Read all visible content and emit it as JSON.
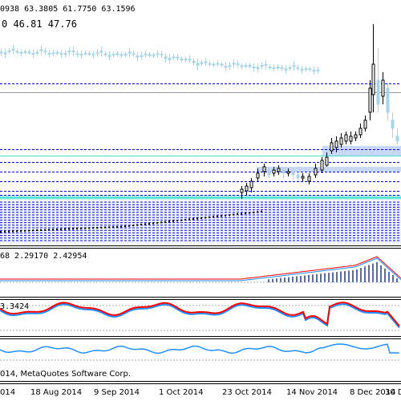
{
  "main": {
    "ohlc_label": "0938 63.3805 61.7750 63.1596",
    "ma_label": "0 46.81 47.76"
  },
  "macd": {
    "label": "68 2.29170 2.42954"
  },
  "stoch": {
    "label": "3.3424"
  },
  "footer": {
    "copyright": "014, MetaQuotes Software Corp."
  },
  "time_axis": {
    "labels": [
      "014",
      "18 Aug 2014",
      "9 Sep 2014",
      "1 Oct 2014",
      "23 Oct 2014",
      "14 Nov 2014",
      "8 Dec 2014",
      "30 De"
    ]
  },
  "colors": {
    "bull_candle": "#000000",
    "bear_candle": "#a8d4e4",
    "level_line": "#0000ff",
    "zone_light_blue": "#c8d8f8",
    "zone_cyan": "#40e0d0",
    "macd_line": "#ff0000",
    "signal_line": "#1e90ff",
    "stoch_main": "#ff0000",
    "stoch_signal": "#1e90ff",
    "rsi_line": "#1e90ff"
  }
}
